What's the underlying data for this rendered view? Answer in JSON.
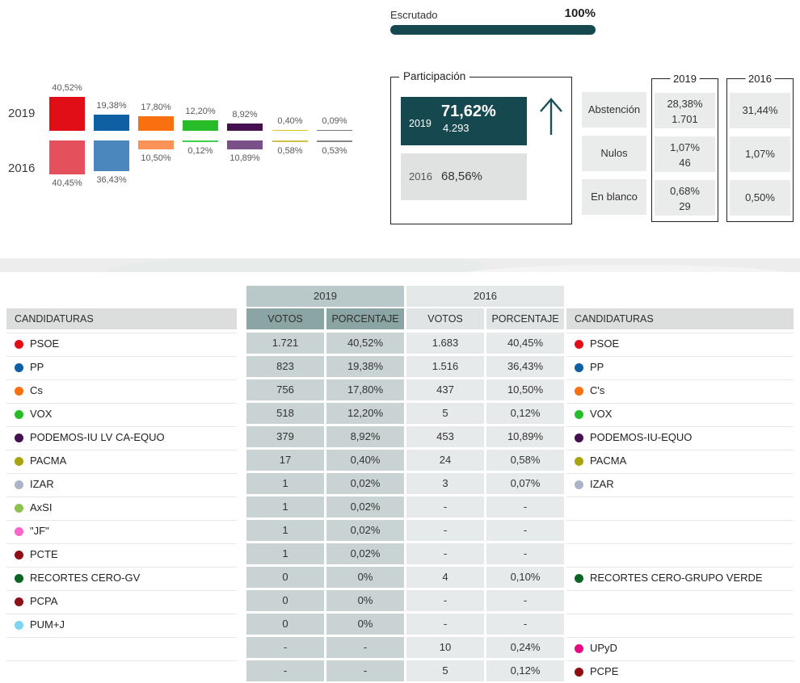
{
  "scrutiny": {
    "label": "Escrutado",
    "value": "100%"
  },
  "chart_data": {
    "type": "bar",
    "layout": "two mirrored rows; 2019 bars bottom-aligned to a common baseline, 2016 bars top-aligned just below it; value labels outside bar ends",
    "row_labels": [
      "2019",
      "2016"
    ],
    "series": [
      {
        "name": "2019",
        "values": [
          40.52,
          19.38,
          17.8,
          12.2,
          8.92,
          0.4,
          0.09
        ],
        "labels": [
          "40,52%",
          "19,38%",
          "17,80%",
          "12,20%",
          "8,92%",
          "0,40%",
          "0,09%"
        ],
        "colors": [
          "#e10e17",
          "#0f5fa5",
          "#f8700f",
          "#28bd28",
          "#461050",
          "#d8c91c",
          "#76777a"
        ]
      },
      {
        "name": "2016",
        "values": [
          40.45,
          36.43,
          10.5,
          0.12,
          10.89,
          0.58,
          0.53
        ],
        "labels": [
          "40,45%",
          "36,43%",
          "10,50%",
          "0,12%",
          "10,89%",
          "0,58%",
          "0,53%"
        ],
        "colors": [
          "#e4515c",
          "#4b87bd",
          "#fb9257",
          "#3fd14b",
          "#7a5088",
          "#cfc04a",
          "#85878a"
        ]
      }
    ]
  },
  "participation": {
    "legend": "Participación",
    "accent_color": "#15494f",
    "trend_icon": "arrow-up",
    "r2019": {
      "year": "2019",
      "pct": "71,62%",
      "votes": "4.293"
    },
    "r2016": {
      "year": "2016",
      "pct": "68,56%"
    }
  },
  "stats": {
    "legend2019": "2019",
    "legend2016": "2016",
    "rows": [
      {
        "label": "Abstención",
        "pct2019": "28,38%",
        "count2019": "1.701",
        "pct2016": "31,44%"
      },
      {
        "label": "Nulos",
        "pct2019": "1,07%",
        "count2019": "46",
        "pct2016": "1,07%"
      },
      {
        "label": "En blanco",
        "pct2019": "0,68%",
        "count2019": "29",
        "pct2016": "0,50%"
      }
    ]
  },
  "results": {
    "year2019": "2019",
    "year2016": "2016",
    "candidaturas_header": "CANDIDATURAS",
    "votos_header": "VOTOS",
    "porcentaje_header": "PORCENTAJE",
    "rows": [
      {
        "left": {
          "name": "PSOE",
          "color": "#e10e17"
        },
        "v2019": "1.721",
        "p2019": "40,52%",
        "v2016": "1.683",
        "p2016": "40,45%",
        "right": {
          "name": "PSOE",
          "color": "#e10e17"
        }
      },
      {
        "left": {
          "name": "PP",
          "color": "#0f5fa5"
        },
        "v2019": "823",
        "p2019": "19,38%",
        "v2016": "1.516",
        "p2016": "36,43%",
        "right": {
          "name": "PP",
          "color": "#0f5fa5"
        }
      },
      {
        "left": {
          "name": "Cs",
          "color": "#f8700f"
        },
        "v2019": "756",
        "p2019": "17,80%",
        "v2016": "437",
        "p2016": "10,50%",
        "right": {
          "name": "C's",
          "color": "#f8700f"
        }
      },
      {
        "left": {
          "name": "VOX",
          "color": "#28bd28"
        },
        "v2019": "518",
        "p2019": "12,20%",
        "v2016": "5",
        "p2016": "0,12%",
        "right": {
          "name": "VOX",
          "color": "#28bd28"
        }
      },
      {
        "left": {
          "name": "PODEMOS-IU LV CA-EQUO",
          "color": "#461050"
        },
        "v2019": "379",
        "p2019": "8,92%",
        "v2016": "453",
        "p2016": "10,89%",
        "right": {
          "name": "PODEMOS-IU-EQUO",
          "color": "#461050"
        }
      },
      {
        "left": {
          "name": "PACMA",
          "color": "#a8a410"
        },
        "v2019": "17",
        "p2019": "0,40%",
        "v2016": "24",
        "p2016": "0,58%",
        "right": {
          "name": "PACMA",
          "color": "#a8a410"
        }
      },
      {
        "left": {
          "name": "IZAR",
          "color": "#aab4c6"
        },
        "v2019": "1",
        "p2019": "0,02%",
        "v2016": "3",
        "p2016": "0,07%",
        "right": {
          "name": "IZAR",
          "color": "#aab4c6"
        }
      },
      {
        "left": {
          "name": "AxSI",
          "color": "#8dc152"
        },
        "v2019": "1",
        "p2019": "0,02%",
        "v2016": "-",
        "p2016": "-",
        "right": null
      },
      {
        "left": {
          "name": "\"JF\"",
          "color": "#f966c8"
        },
        "v2019": "1",
        "p2019": "0,02%",
        "v2016": "-",
        "p2016": "-",
        "right": null
      },
      {
        "left": {
          "name": "PCTE",
          "color": "#8c0d17"
        },
        "v2019": "1",
        "p2019": "0,02%",
        "v2016": "-",
        "p2016": "-",
        "right": null
      },
      {
        "left": {
          "name": "RECORTES CERO-GV",
          "color": "#0c6424"
        },
        "v2019": "0",
        "p2019": "0%",
        "v2016": "4",
        "p2016": "0,10%",
        "right": {
          "name": "RECORTES CERO-GRUPO VERDE",
          "color": "#0c6424"
        }
      },
      {
        "left": {
          "name": "PCPA",
          "color": "#8c1118"
        },
        "v2019": "0",
        "p2019": "0%",
        "v2016": "-",
        "p2016": "-",
        "right": null
      },
      {
        "left": {
          "name": "PUM+J",
          "color": "#7fd4f2"
        },
        "v2019": "0",
        "p2019": "0%",
        "v2016": "-",
        "p2016": "-",
        "right": null
      },
      {
        "left": null,
        "v2019": "-",
        "p2019": "-",
        "v2016": "10",
        "p2016": "0,24%",
        "right": {
          "name": "UPyD",
          "color": "#e60a87"
        }
      },
      {
        "left": null,
        "v2019": "-",
        "p2019": "-",
        "v2016": "5",
        "p2016": "0,12%",
        "right": {
          "name": "PCPE",
          "color": "#900d12"
        }
      }
    ]
  }
}
